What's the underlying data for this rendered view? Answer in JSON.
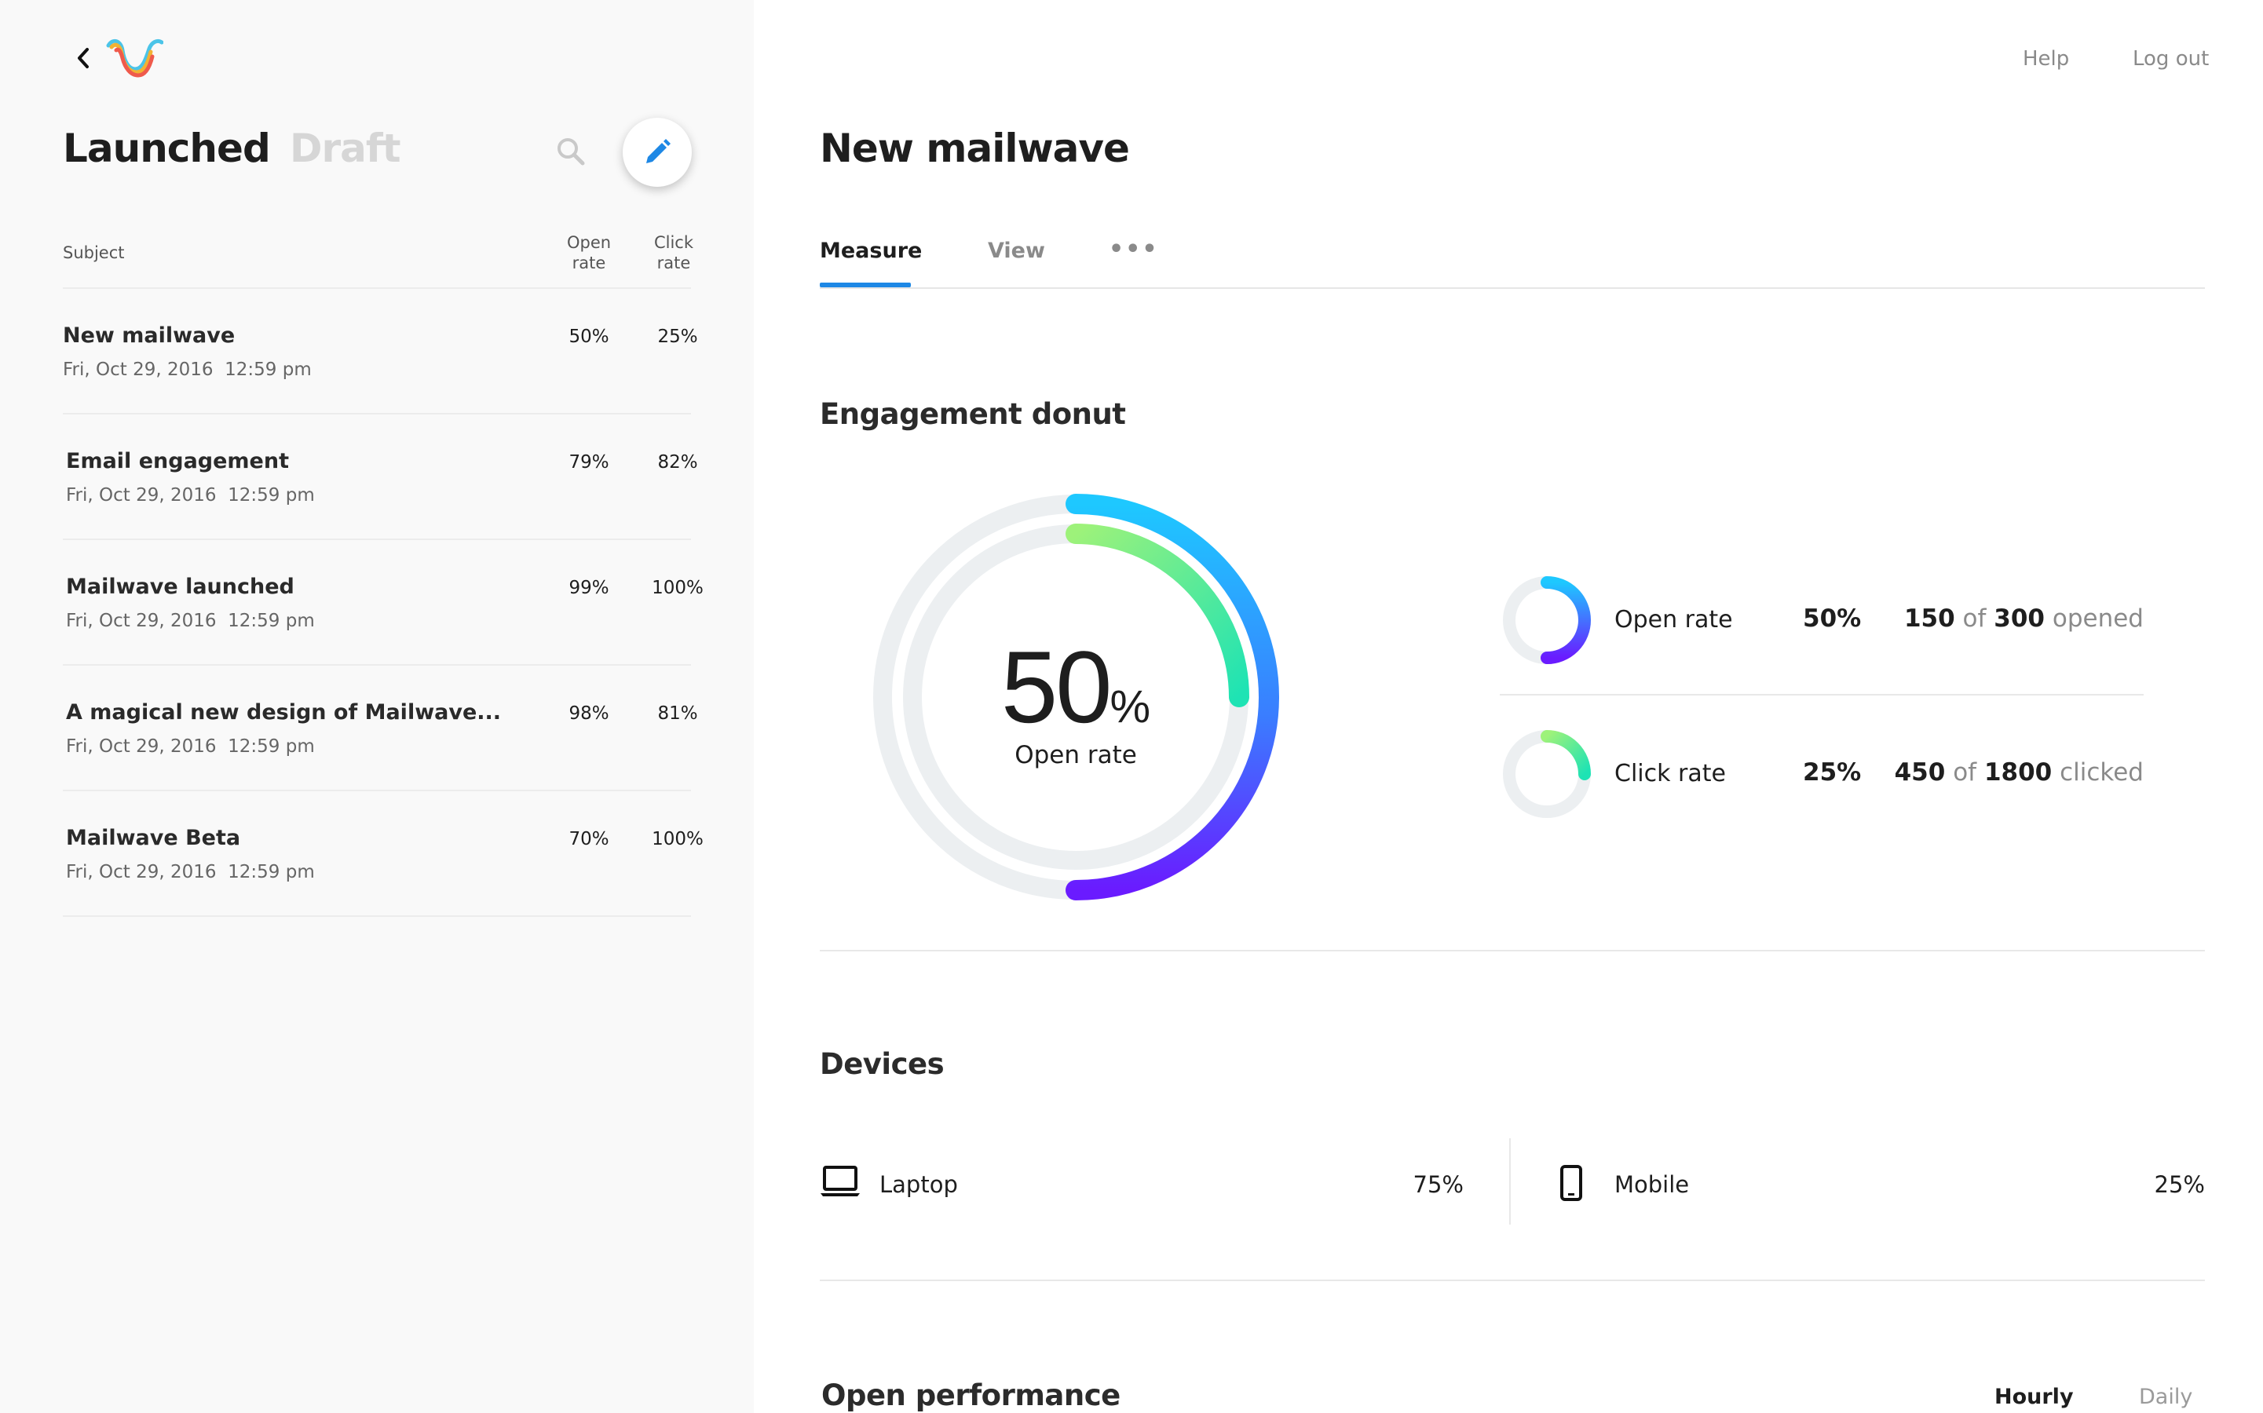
{
  "sidebar": {
    "tabs": {
      "launched": "Launched",
      "draft": "Draft"
    },
    "columns": {
      "subject": "Subject",
      "open_rate": "Open\nrate",
      "click_rate": "Click\nrate"
    },
    "rows": [
      {
        "subject": "New mailwave",
        "date": "Fri, Oct 29, 2016  12:59 pm",
        "open": "50%",
        "click": "25%"
      },
      {
        "subject": "Email engagement",
        "date": "Fri, Oct 29, 2016  12:59 pm",
        "open": "79%",
        "click": "82%"
      },
      {
        "subject": "Mailwave launched",
        "date": "Fri, Oct 29, 2016  12:59 pm",
        "open": "99%",
        "click": "100%"
      },
      {
        "subject": "A magical new design of Mailwave...",
        "date": "Fri, Oct 29, 2016  12:59 pm",
        "open": "98%",
        "click": "81%"
      },
      {
        "subject": "Mailwave Beta",
        "date": "Fri, Oct 29, 2016  12:59 pm",
        "open": "70%",
        "click": "100%"
      }
    ]
  },
  "header": {
    "help": "Help",
    "logout": "Log out"
  },
  "main": {
    "title": "New mailwave",
    "tabs": {
      "measure": "Measure",
      "view": "View",
      "more": "•••"
    },
    "engagement": {
      "title": "Engagement donut",
      "big_value": "50",
      "big_unit": "%",
      "big_label": "Open rate",
      "open_rate_fraction": 0.5,
      "click_rate_fraction": 0.25,
      "stats": [
        {
          "label": "Open rate",
          "pct": "50%",
          "count": "150",
          "of": "of",
          "total": "300",
          "suffix": "opened"
        },
        {
          "label": "Click rate",
          "pct": "25%",
          "count": "450",
          "of": "of",
          "total": "1800",
          "suffix": "clicked"
        }
      ]
    },
    "devices": {
      "title": "Devices",
      "items": [
        {
          "label": "Laptop",
          "pct": "75%",
          "icon": "laptop-icon"
        },
        {
          "label": "Mobile",
          "pct": "25%",
          "icon": "mobile-icon"
        }
      ]
    },
    "open_performance": {
      "title": "Open performance",
      "hourly": "Hourly",
      "daily": "Daily"
    }
  },
  "colors": {
    "accent": "#1e88e5",
    "open_gradient": [
      "#1ec8ff",
      "#6a1bff"
    ],
    "click_gradient": [
      "#9df27a",
      "#1ee3b4"
    ],
    "track": "#eceff1"
  }
}
